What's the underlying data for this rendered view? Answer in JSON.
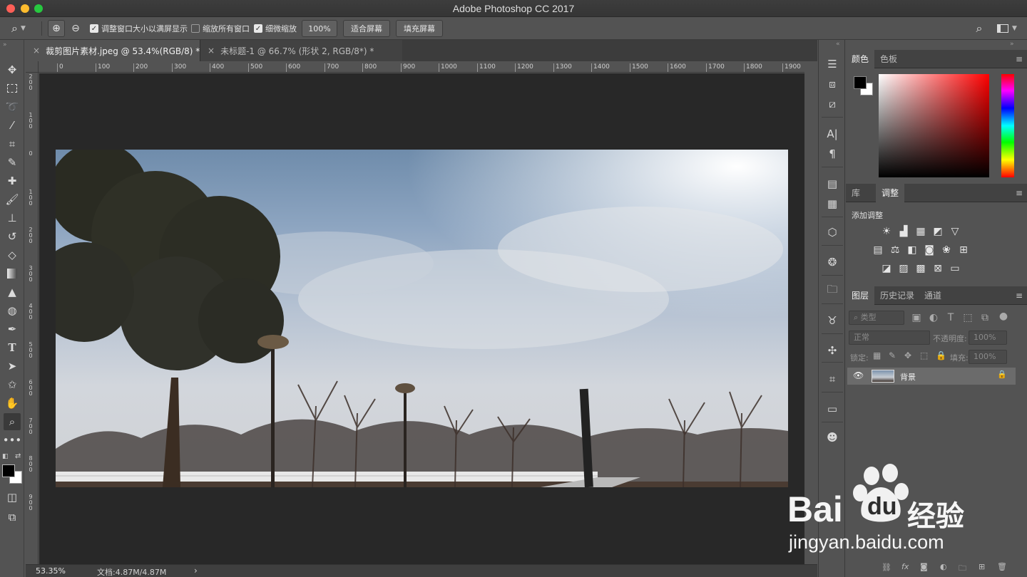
{
  "window": {
    "title": "Adobe Photoshop CC 2017"
  },
  "options_bar": {
    "resize_windows_label": "调整窗口大小以满屏显示",
    "zoom_all_label": "缩放所有窗口",
    "scrubby_zoom_label": "细微缩放",
    "zoom_value": "100%",
    "fit_screen_label": "适合屏幕",
    "fill_screen_label": "填充屏幕",
    "checks": {
      "resize_windows": true,
      "zoom_all": false,
      "scrubby_zoom": true
    }
  },
  "tabs": [
    {
      "label": "裁剪图片素材.jpeg @ 53.4%(RGB/8) *",
      "active": true
    },
    {
      "label": "未标题-1 @ 66.7% (形状 2, RGB/8*) *",
      "active": false
    }
  ],
  "ruler": {
    "h_ticks": [
      "0",
      "100",
      "200",
      "300",
      "400",
      "500",
      "600",
      "700",
      "800",
      "900",
      "1000",
      "1100",
      "1200",
      "1300",
      "1400",
      "1500",
      "1600",
      "1700",
      "1800",
      "1900"
    ],
    "v_ticks": [
      "200",
      "100",
      "0",
      "100",
      "200",
      "300",
      "400",
      "500",
      "600",
      "700",
      "800",
      "900"
    ]
  },
  "status": {
    "zoom": "53.35%",
    "doc_info": "文档:4.87M/4.87M",
    "arrow": "›"
  },
  "color_panel": {
    "tabs": [
      "颜色",
      "色板"
    ],
    "foreground": "#000000",
    "background": "#ffffff"
  },
  "adjust_panel": {
    "tabs": [
      "库",
      "调整"
    ],
    "title": "添加调整"
  },
  "layers_panel": {
    "tabs": [
      "图层",
      "历史记录",
      "通道"
    ],
    "filter_placeholder": "类型",
    "blend_mode": "正常",
    "opacity_label": "不透明度:",
    "opacity_value": "100%",
    "lock_label": "锁定:",
    "fill_label": "填充:",
    "fill_value": "100%",
    "layers": [
      {
        "name": "背景",
        "visible": true,
        "locked": true
      }
    ]
  },
  "watermark": {
    "brand": "Bai",
    "brand2": "du",
    "cn": "经验",
    "url": "jingyan.baidu.com"
  },
  "colors": {
    "ui_bg": "#535353",
    "canvas_bg": "#282828",
    "panel_tab_bg": "#424242"
  }
}
